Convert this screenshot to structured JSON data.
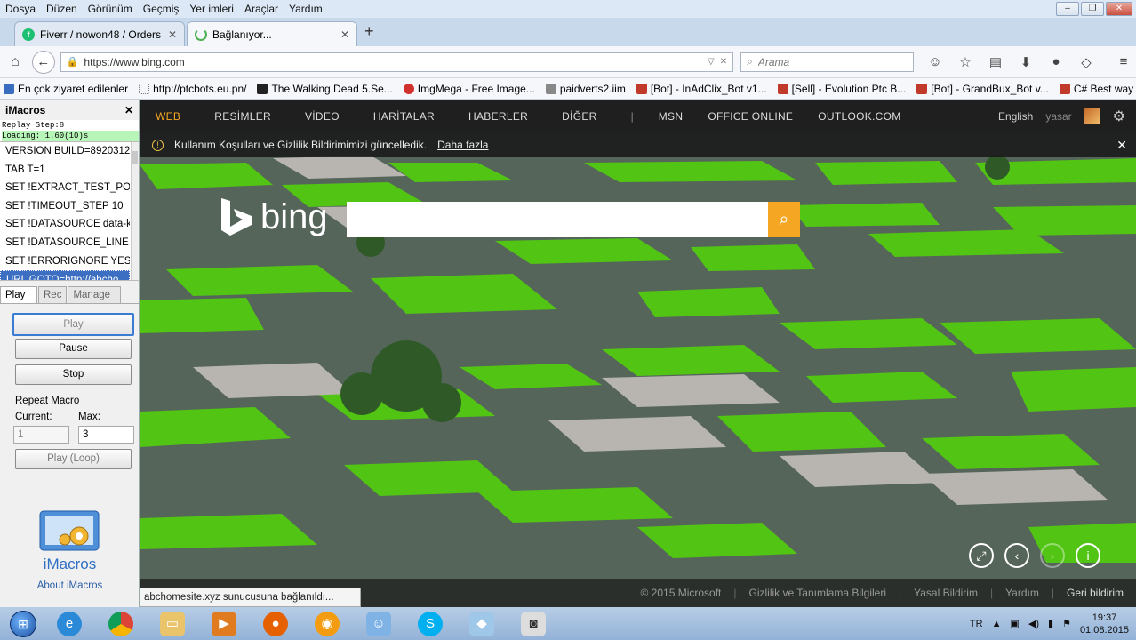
{
  "menu": [
    "Dosya",
    "Düzen",
    "Görünüm",
    "Geçmiş",
    "Yer imleri",
    "Araçlar",
    "Yardım"
  ],
  "tabs": [
    {
      "label": "Fiverr / nowon48 / Orders ..."
    },
    {
      "label": "Bağlanıyor..."
    }
  ],
  "nav": {
    "url": "https://www.bing.com",
    "search_placeholder": "Arama"
  },
  "bookmarks": [
    {
      "label": "En çok ziyaret edilenler",
      "color": "#3a6cc0"
    },
    {
      "label": "http://ptcbots.eu.pn/",
      "color": "#ffffff"
    },
    {
      "label": "The Walking Dead 5.Se...",
      "color": "#222222"
    },
    {
      "label": "ImgMega - Free Image...",
      "color": "#d0312d"
    },
    {
      "label": "paidverts2.iim",
      "color": "#888888"
    },
    {
      "label": "[Bot] - InAdClix_Bot v1...",
      "color": "#c0392b"
    },
    {
      "label": "[Sell] - Evolution Ptc B...",
      "color": "#c0392b"
    },
    {
      "label": "[Bot] - GrandBux_Bot v...",
      "color": "#c0392b"
    },
    {
      "label": "C# Best way to delay",
      "color": "#c0392b"
    }
  ],
  "imacros": {
    "title": "iMacros",
    "replay_step": "Replay Step:8",
    "loading": "Loading: 1.60(10)s",
    "lines": [
      "VERSION BUILD=8920312 ...",
      "TAB T=1",
      "SET !EXTRACT_TEST_POP...",
      "SET !TIMEOUT_STEP 10",
      "SET !DATASOURCE data-k...",
      "SET !DATASOURCE_LINE {{...",
      "SET !ERRORIGNORE YES",
      "URL GOTO=http://abcho..."
    ],
    "tabs": [
      "Play",
      "Rec",
      "Manage"
    ],
    "play": "Play",
    "pause": "Pause",
    "stop": "Stop",
    "repeat_label": "Repeat Macro",
    "current_label": "Current:",
    "max_label": "Max:",
    "current_value": "1",
    "max_value": "3",
    "play_loop": "Play (Loop)",
    "brand": "iMacros",
    "about": "About iMacros"
  },
  "bing": {
    "nav": [
      "WEB",
      "RESİMLER",
      "VİDEO",
      "HARİTALAR",
      "HABERLER",
      "DİĞER",
      "MSN",
      "OFFICE ONLINE",
      "OUTLOOK.COM"
    ],
    "language": "English",
    "user": "yasar",
    "notice": "Kullanım Koşulları ve Gizlilik Bildirimimizi güncelledik.",
    "notice_link": "Daha fazla",
    "logo_text": "bing",
    "footer": [
      "© 2015 Microsoft",
      "Gizlilik ve Tanımlama Bilgileri",
      "Yasal Bildirim",
      "Yardım",
      "Geri bildirim"
    ],
    "accent": "#f5a623"
  },
  "status": "abchomesite.xyz sunucusuna bağlanıldı...",
  "tray": {
    "lang": "TR",
    "time": "19:37",
    "date": "01.08.2015"
  }
}
